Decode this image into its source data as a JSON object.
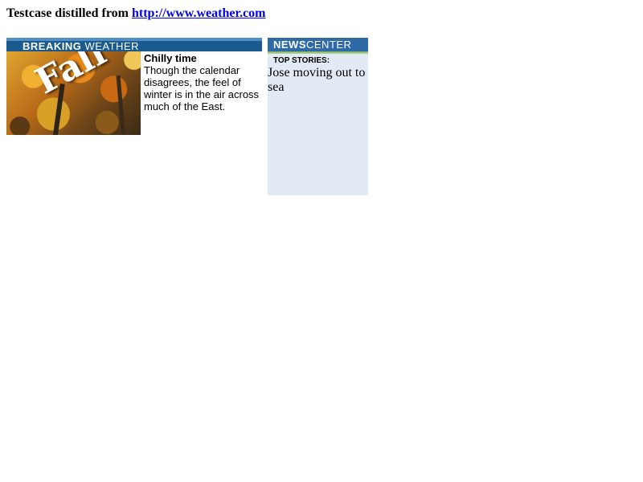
{
  "heading": {
    "prefix": "Testcase distilled from ",
    "link_text": "http://www.weather.com"
  },
  "breaking_weather": {
    "header_bold": "BREAKING",
    "header_light": "WEATHER",
    "photo_caption": "Fall",
    "story": {
      "headline": "Chilly time",
      "summary": "Though the calendar disagrees, the feel of winter is in the air across much of the East."
    }
  },
  "news_center": {
    "header_bold": "NEWS",
    "header_light": "CENTER",
    "section_label": "TOP STORIES:",
    "stories": [
      "Jose moving out to sea"
    ]
  },
  "colors": {
    "link": "#0000ee",
    "breaking_header_bg": "#1a5a8e",
    "news_header_bg": "#2d6aa6",
    "news_panel_bg": "#e1eaf5",
    "news_accent": "#7fb05a"
  }
}
